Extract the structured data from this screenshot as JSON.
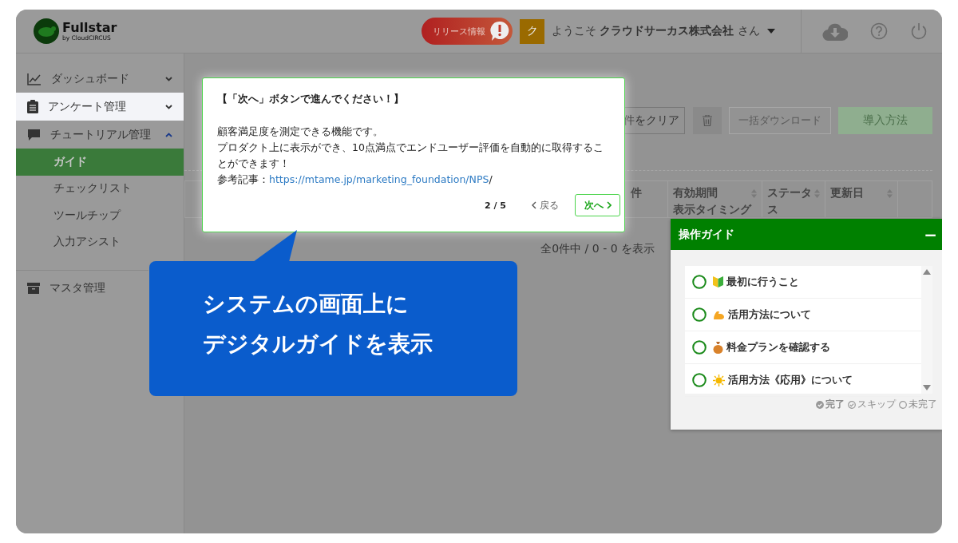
{
  "header": {
    "brand": "Fullstar",
    "brand_sub": "by CloudCIRCUS",
    "release_button": "リリース情報",
    "avatar": "ク",
    "welcome": "ようこそ **クラウドサーカス株式会社** さん"
  },
  "sidebar": {
    "items": [
      {
        "label": "ダッシュボード",
        "expanded": false,
        "highlighted": false,
        "selected": false
      },
      {
        "label": "アンケート管理",
        "expanded": false,
        "highlighted": true,
        "selected": false
      },
      {
        "label": "チュートリアル管理",
        "expanded": true,
        "highlighted": false,
        "selected": false,
        "children": [
          {
            "label": "ガイド",
            "selected": true
          },
          {
            "label": "チェックリスト",
            "selected": false
          },
          {
            "label": "ツールチップ",
            "selected": false
          },
          {
            "label": "入力アシスト",
            "selected": false
          }
        ]
      },
      {
        "label": "マスタ管理",
        "highlighted": false,
        "selected": false
      }
    ]
  },
  "toolbar": [
    {
      "kind": "outline",
      "label": "件をクリア"
    },
    {
      "kind": "trash"
    },
    {
      "kind": "disabled",
      "label": "一括ダウンロード"
    },
    {
      "kind": "primary",
      "label": "導入方法"
    }
  ],
  "table": {
    "columns": [
      {
        "lines": [
          "件"
        ],
        "sortable": false
      },
      {
        "lines": [
          "有効期間",
          "表示タイミング"
        ],
        "sortable": true
      },
      {
        "lines": [
          "ステータ",
          "ス"
        ],
        "sortable": true
      },
      {
        "lines": [
          "更新日"
        ],
        "sortable": true
      },
      {
        "sortable": false
      }
    ],
    "summary": "全0件中 / 0 - 0 を表示"
  },
  "tooltip": {
    "title": "【「次へ」ボタンで進んでください！】",
    "body": [
      "顧客満足度を測定できる機能です。",
      "プロダクト上に表示ができ、10点満点でエンドユーザー評価を自動的に取得することができます！"
    ],
    "ref_label": "参考記事：",
    "link": "https://mtame.jp/marketing_foundation/NPS",
    "ref_suffix": "/",
    "step": "2 / 5",
    "back": "戻る",
    "next": "次へ"
  },
  "callout": {
    "lines": [
      "システムの画面上に",
      "デジタルガイドを表示"
    ]
  },
  "guide_panel": {
    "title": "操作ガイド",
    "minimize": "−",
    "items": [
      {
        "label": "最初に行うこと",
        "done": false
      },
      {
        "label": "活用方法について",
        "done": false
      },
      {
        "label": "料金プランを確認する",
        "done": false
      },
      {
        "label": "活用方法《応用》について",
        "done": false
      }
    ],
    "legend": [
      {
        "kind": "done",
        "label": "完了"
      },
      {
        "kind": "skip",
        "label": "スキップ"
      },
      {
        "kind": "todo",
        "label": "未完了"
      }
    ]
  }
}
